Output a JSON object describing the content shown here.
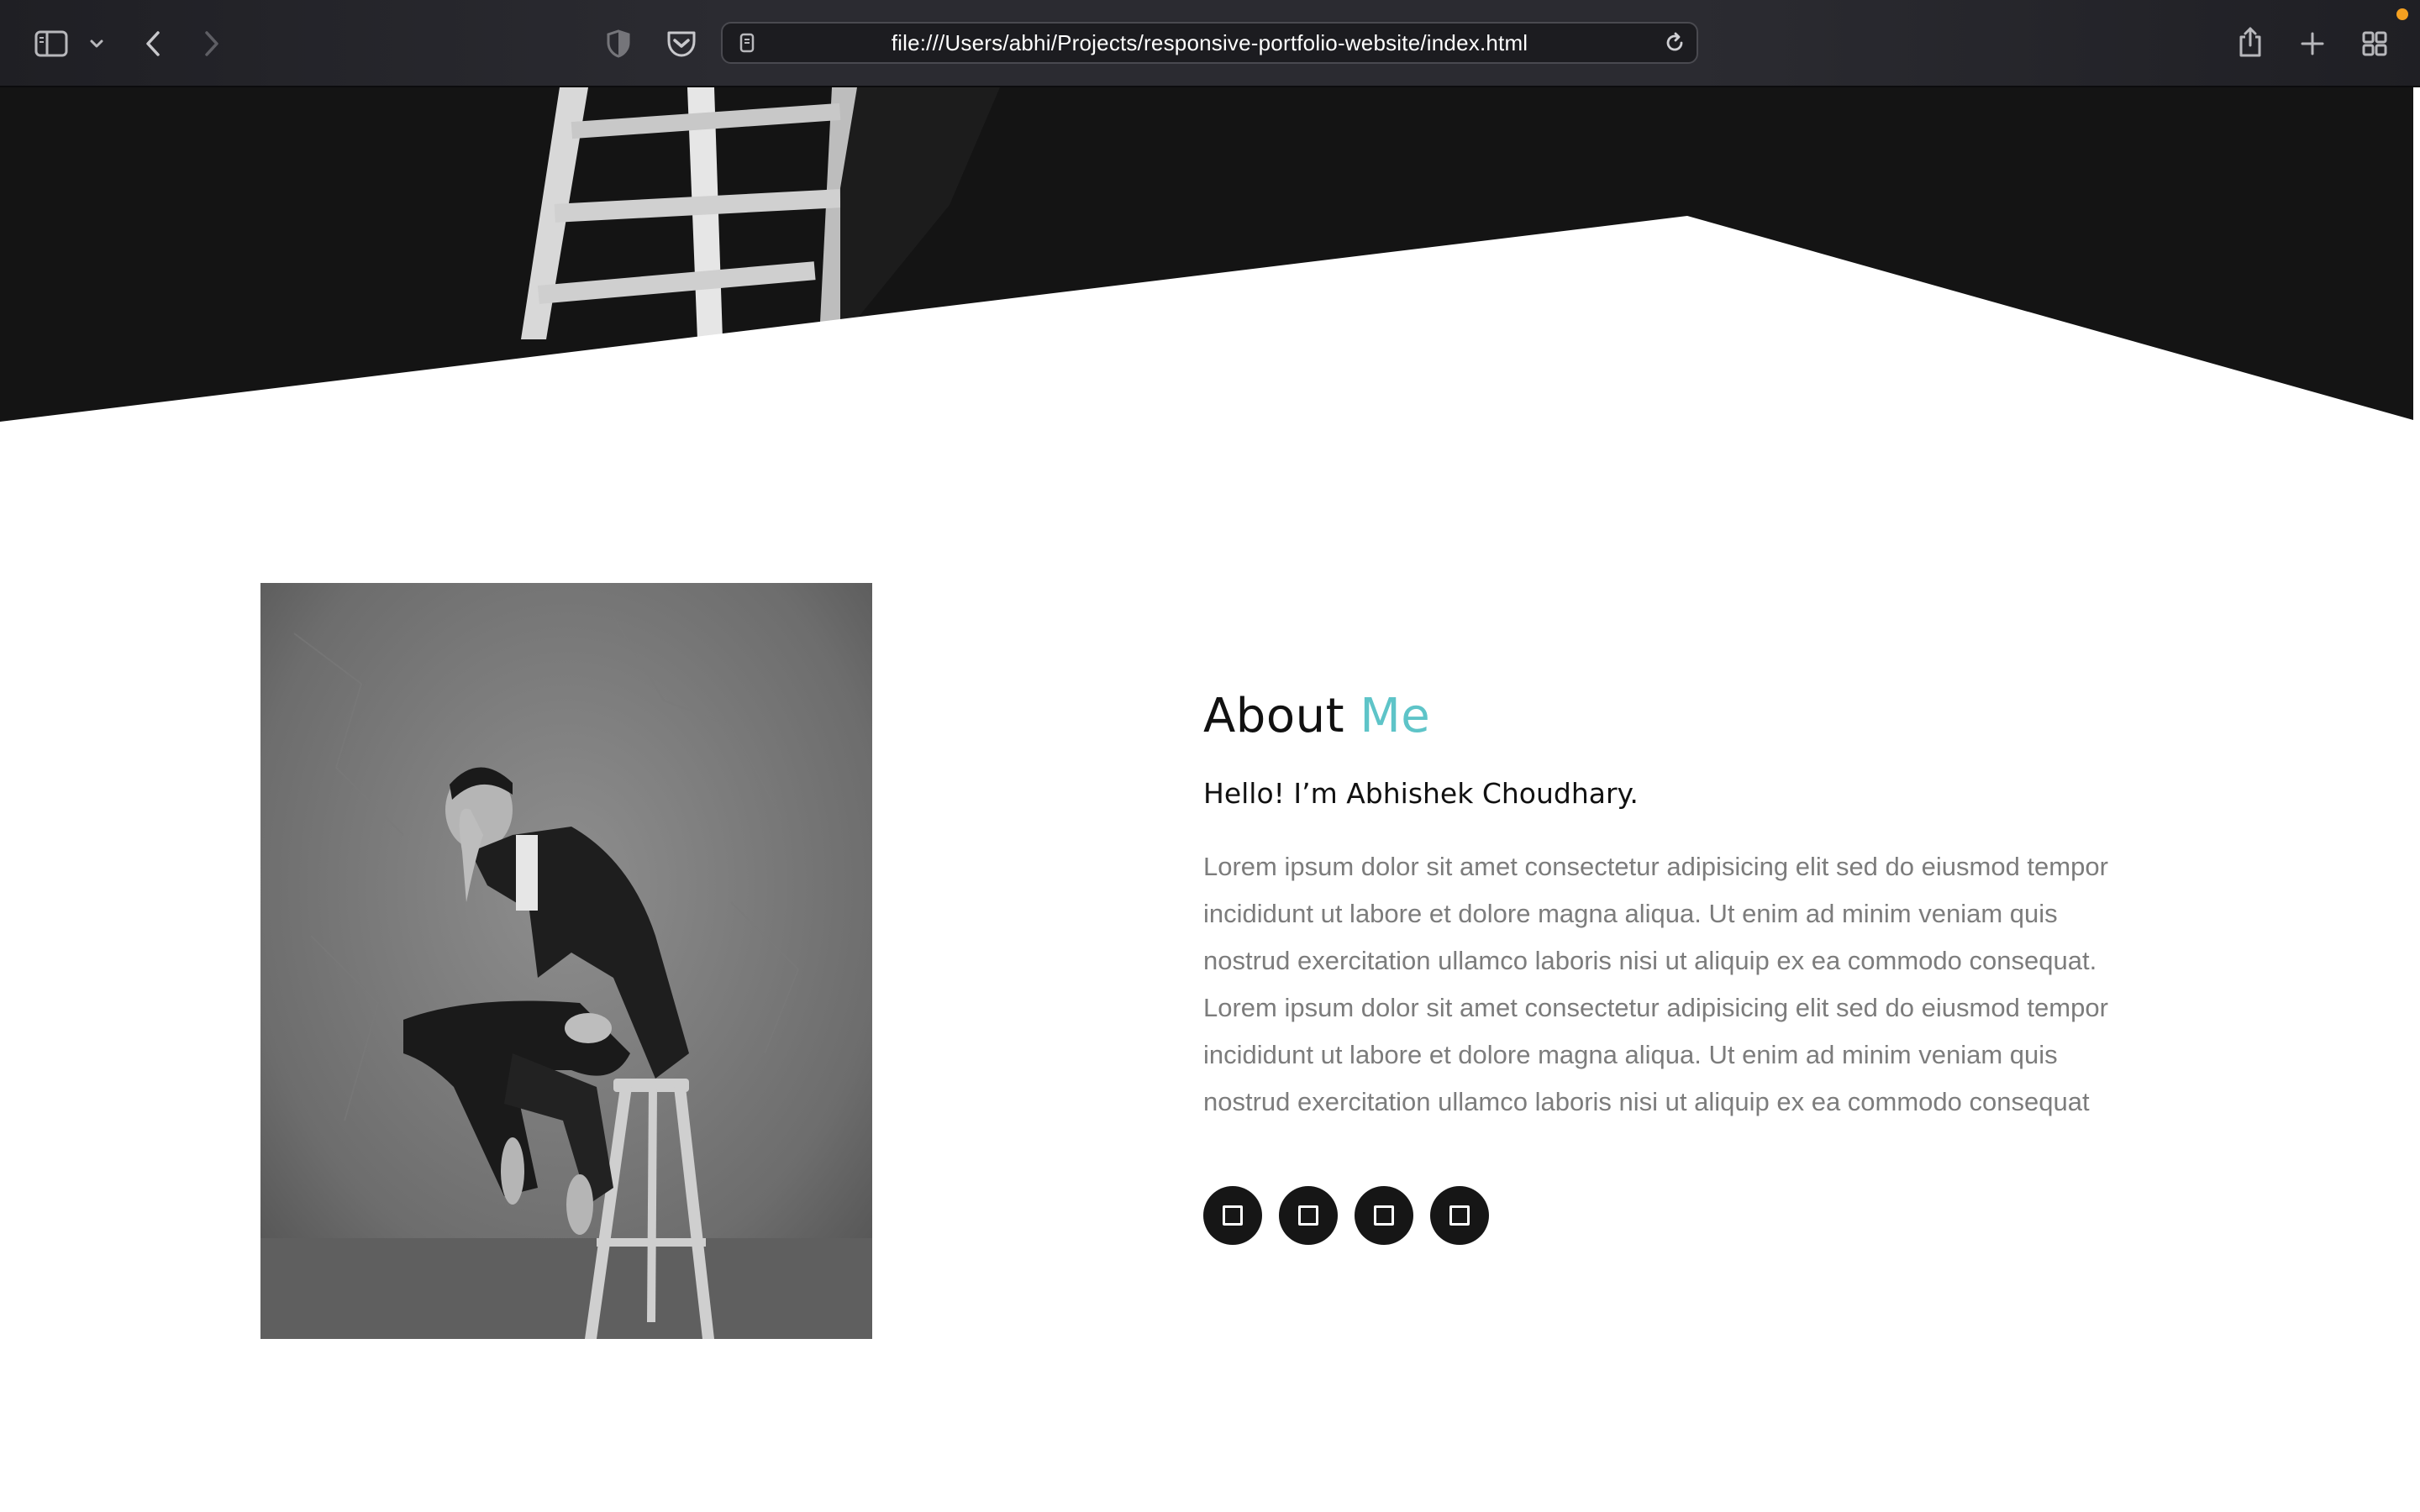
{
  "browser": {
    "url": "file:///Users/abhi/Projects/responsive-portfolio-website/index.html",
    "icons": {
      "sidebar": "sidebar-icon",
      "sidebar_menu": "chevron-down-icon",
      "back": "chevron-left-icon",
      "forward": "chevron-right-icon",
      "privacy": "shield-icon",
      "pocket": "pocket-icon",
      "page": "page-icon",
      "reload": "reload-icon",
      "share": "share-icon",
      "new_tab": "plus-icon",
      "tabs_overview": "grid-icon"
    },
    "status_dot_color": "#f4a020"
  },
  "about": {
    "title_main": "About",
    "title_accent": "Me",
    "accent_color": "#5ec4c8",
    "subtitle": "Hello! I’m Abhishek Choudhary.",
    "paragraph": "Lorem ipsum dolor sit amet consectetur adipisicing elit sed do eiusmod tempor incididunt ut labore et dolore magna aliqua. Ut enim ad minim veniam quis nostrud exercitation ullamco laboris nisi ut aliquip ex ea commodo consequat. Lorem ipsum dolor sit amet consectetur adipisicing elit sed do eiusmod tempor incididunt ut labore et dolore magna aliqua. Ut enim ad minim veniam quis nostrud exercitation ullamco laboris nisi ut aliquip ex ea commodo consequat",
    "social_icons": [
      "square-icon",
      "square-icon",
      "square-icon",
      "square-icon"
    ]
  }
}
